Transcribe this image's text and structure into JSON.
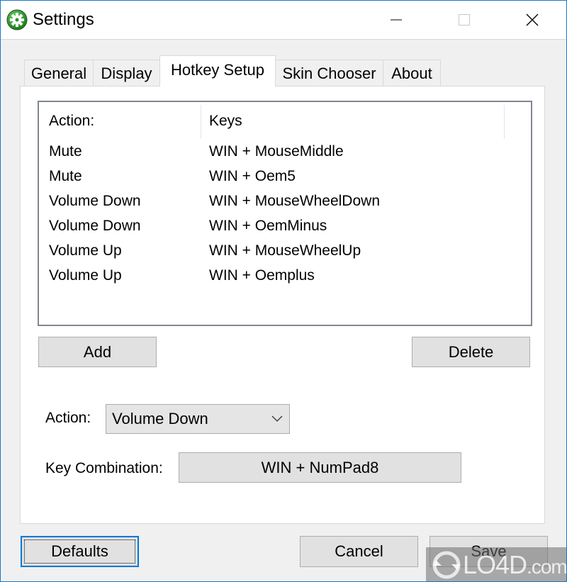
{
  "window": {
    "title": "Settings",
    "icon": "gear-icon",
    "controls": {
      "minimize": "minimize-icon",
      "maximize": "maximize-icon",
      "close": "close-icon"
    }
  },
  "tabs": [
    {
      "label": "General",
      "active": false
    },
    {
      "label": "Display",
      "active": false
    },
    {
      "label": "Hotkey Setup",
      "active": true
    },
    {
      "label": "Skin Chooser",
      "active": false
    },
    {
      "label": "About",
      "active": false
    }
  ],
  "hotkey_list": {
    "columns": [
      "Action:",
      "Keys"
    ],
    "rows": [
      {
        "action": "Mute",
        "keys": "WIN + MouseMiddle"
      },
      {
        "action": "Mute",
        "keys": "WIN + Oem5"
      },
      {
        "action": "Volume Down",
        "keys": "WIN + MouseWheelDown"
      },
      {
        "action": "Volume Down",
        "keys": "WIN + OemMinus"
      },
      {
        "action": "Volume Up",
        "keys": "WIN + MouseWheelUp"
      },
      {
        "action": "Volume Up",
        "keys": "WIN + Oemplus"
      }
    ]
  },
  "list_buttons": {
    "add": "Add",
    "delete": "Delete"
  },
  "editor": {
    "action_label": "Action:",
    "action_value": "Volume Down",
    "key_combination_label": "Key Combination:",
    "key_combination_value": "WIN + NumPad8"
  },
  "footer": {
    "defaults": "Defaults",
    "cancel": "Cancel",
    "save": "Save"
  },
  "watermark": {
    "text": "LO4D",
    "suffix": ".com"
  },
  "colors": {
    "accent": "#0078d7",
    "window_border": "#1979ca",
    "button_face": "#e1e1e1",
    "dialog_bg": "#f0f0f0"
  }
}
